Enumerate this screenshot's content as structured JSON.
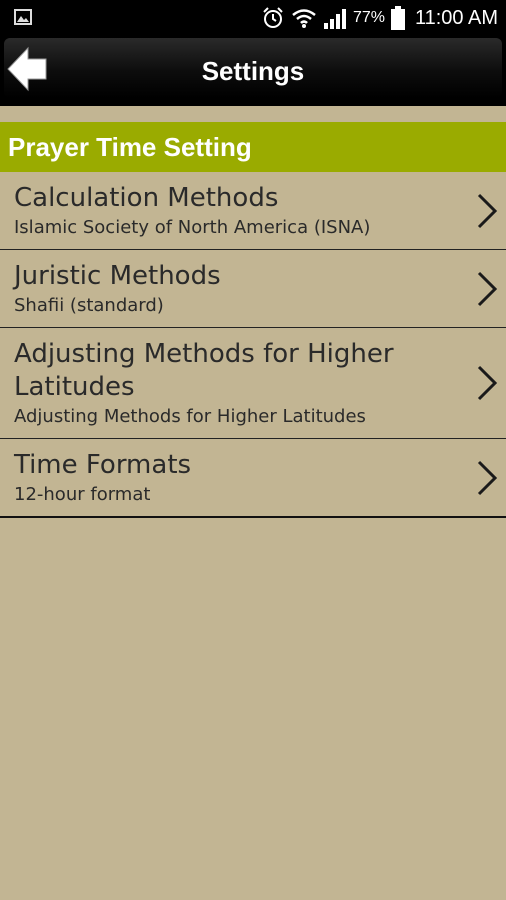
{
  "status_bar": {
    "battery_percent": "77%",
    "time": "11:00 AM",
    "icons": [
      "gallery-icon",
      "alarm-icon",
      "wifi-icon",
      "signal-icon",
      "battery-icon"
    ]
  },
  "title_bar": {
    "title": "Settings",
    "back_icon": "back-arrow-icon"
  },
  "section": {
    "header": "Prayer Time Setting",
    "color": "#9aab00"
  },
  "settings": [
    {
      "title": "Calculation Methods",
      "subtitle": "Islamic Society of North America (ISNA)"
    },
    {
      "title": "Juristic Methods",
      "subtitle": "Shafii (standard)"
    },
    {
      "title": "Adjusting Methods for Higher Latitudes",
      "subtitle": "Adjusting Methods for Higher Latitudes"
    },
    {
      "title": "Time Formats",
      "subtitle": "12-hour format"
    }
  ],
  "colors": {
    "background": "#c2b593",
    "accent": "#9aab00",
    "text": "#2a2a2a"
  }
}
